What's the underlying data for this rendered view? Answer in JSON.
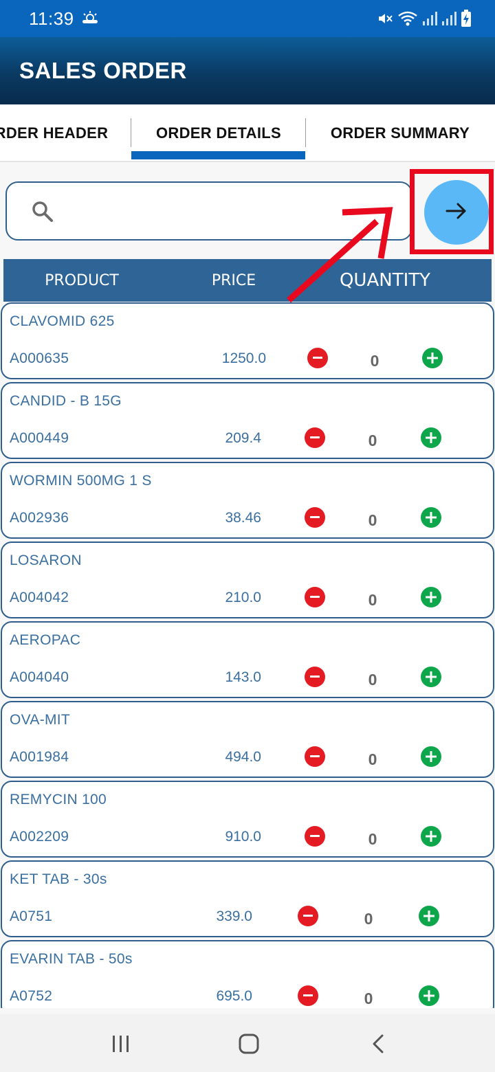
{
  "status_bar": {
    "time": "11:39"
  },
  "app_bar": {
    "title": "SALES ORDER"
  },
  "tabs": [
    {
      "label": "ORDER HEADER",
      "visible_text": "RDER HEADER",
      "selected": false
    },
    {
      "label": "ORDER DETAILS",
      "selected": true
    },
    {
      "label": "ORDER SUMMARY",
      "selected": false
    }
  ],
  "search": {
    "value": "",
    "icon": "search-icon"
  },
  "go_button": {
    "icon": "arrow-right-icon"
  },
  "columns": {
    "product": "PRODUCT",
    "price": "PRICE",
    "quantity": "QUANTITY"
  },
  "products": [
    {
      "name": "CLAVOMID 625",
      "code": "A000635",
      "price": "1250.0",
      "qty": "0"
    },
    {
      "name": "CANDID - B 15G",
      "code": "A000449",
      "price": "209.4",
      "qty": "0"
    },
    {
      "name": "WORMIN 500MG 1 S",
      "code": "A002936",
      "price": "38.46",
      "qty": "0"
    },
    {
      "name": "LOSARON",
      "code": "A004042",
      "price": "210.0",
      "qty": "0"
    },
    {
      "name": "AEROPAC",
      "code": "A004040",
      "price": "143.0",
      "qty": "0"
    },
    {
      "name": "OVA-MIT",
      "code": "A001984",
      "price": "494.0",
      "qty": "0"
    },
    {
      "name": "REMYCIN 100",
      "code": "A002209",
      "price": "910.0",
      "qty": "0"
    },
    {
      "name": "KET TAB - 30s",
      "code": "A0751",
      "price": "339.0",
      "qty": "0"
    },
    {
      "name": "EVARIN TAB - 50s",
      "code": "A0752",
      "price": "695.0",
      "qty": "0"
    }
  ],
  "colors": {
    "status_bar": "#0a66bd",
    "header_blue": "#2f6496",
    "text_blue": "#3a6fa0",
    "minus_red": "#e41b23",
    "plus_green": "#0ea64a",
    "go_button": "#5ab8f7",
    "annotation_red": "#e8091e"
  }
}
